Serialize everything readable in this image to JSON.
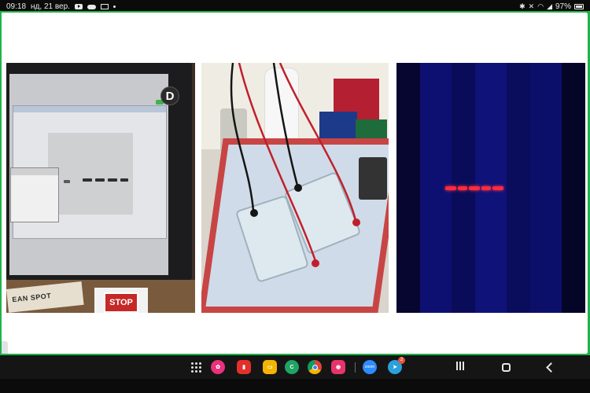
{
  "status_bar": {
    "time": "09:18",
    "date": "нд, 21 вер.",
    "battery": "97%"
  },
  "meeting": {
    "border_color": "#1fb34a",
    "avatar_initial": "D"
  },
  "slide": {
    "photos": [
      {
        "name": "monitor-with-gel-image"
      },
      {
        "name": "electrophoresis-tanks"
      },
      {
        "name": "fluorescent-gel"
      }
    ],
    "labels": {
      "box_text": "EAN SPOT",
      "sign_text": "STOP"
    }
  },
  "taskbar": {
    "apps": [
      {
        "name": "apps-grid-icon"
      },
      {
        "name": "flower-app-icon",
        "color": "#e8327b"
      },
      {
        "name": "flipboard-icon",
        "color": "#e2302b"
      },
      {
        "name": "notes-icon",
        "color": "#f4b400"
      },
      {
        "name": "phone-icon",
        "color": "#1fa463"
      },
      {
        "name": "chrome-icon"
      },
      {
        "name": "screen-recorder-icon",
        "color": "#e8336b"
      },
      {
        "name": "zoom-icon",
        "label": "zoom",
        "color": "#2d8cff"
      },
      {
        "name": "telegram-icon",
        "color": "#2aa1da",
        "badge": "2"
      }
    ]
  }
}
